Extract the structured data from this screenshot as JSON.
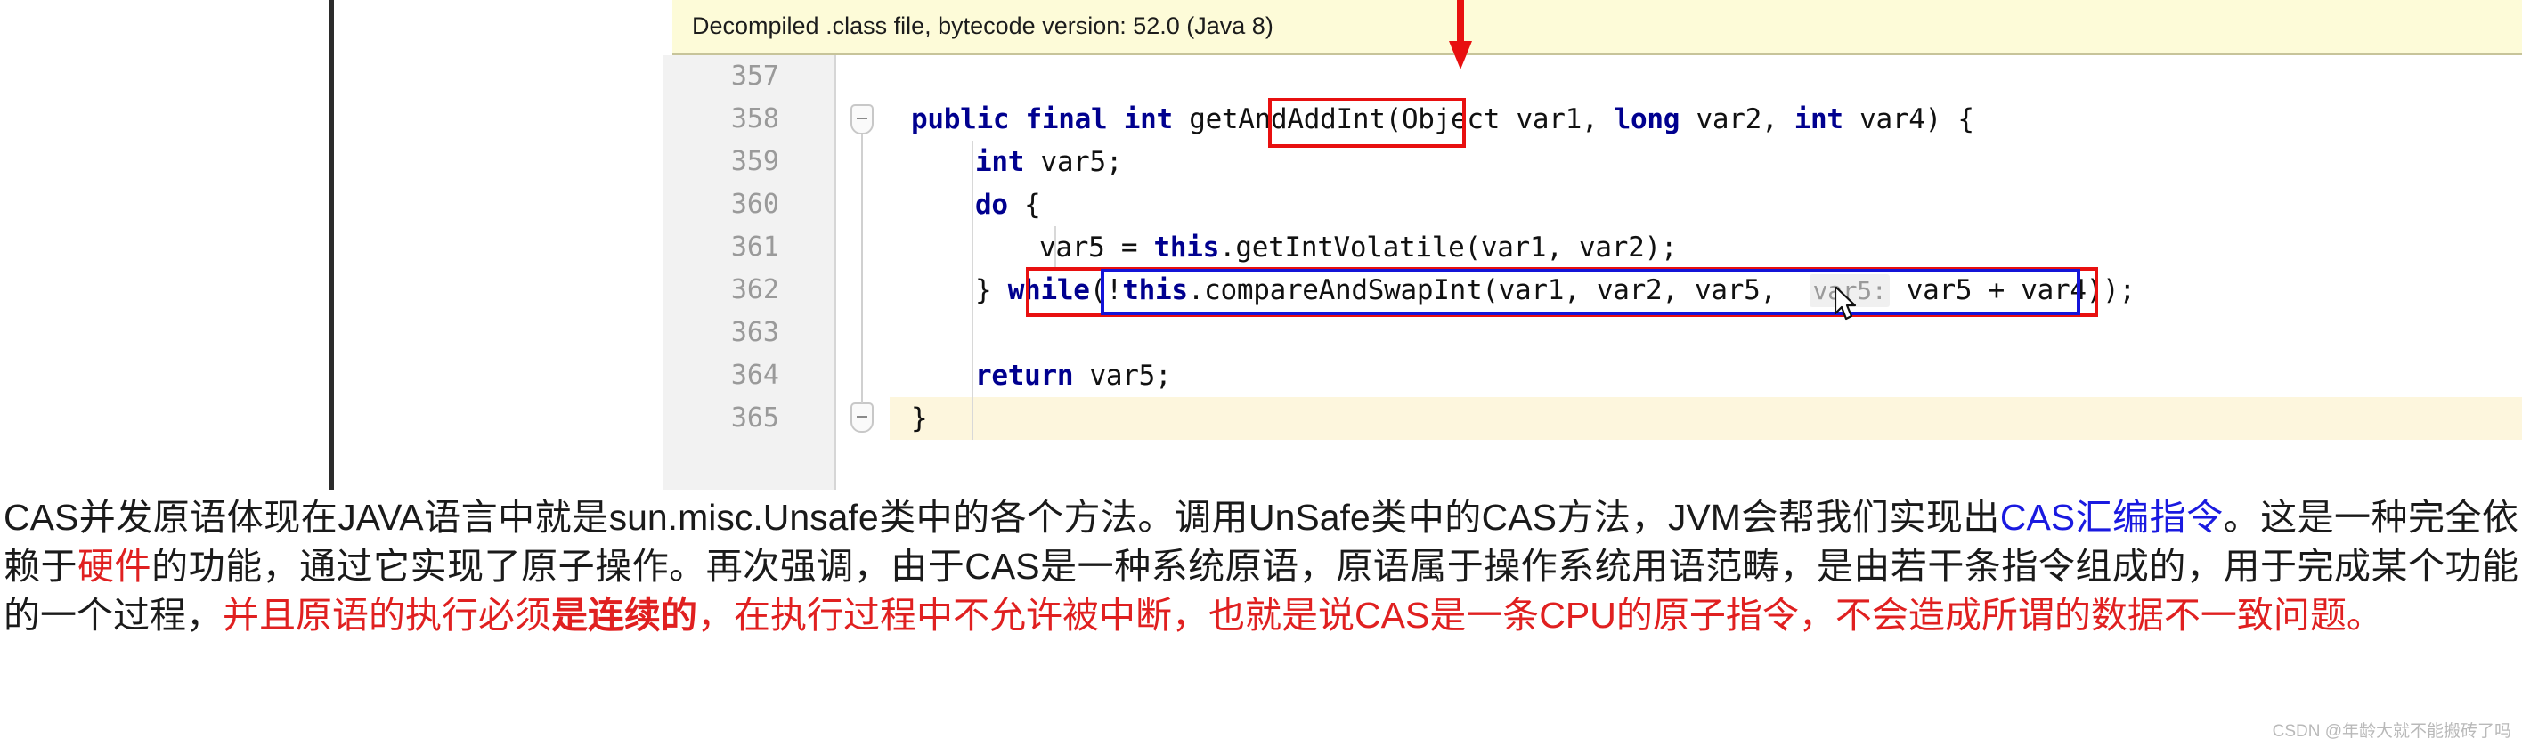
{
  "editor": {
    "banner": {
      "text": "Decompiled .class file, bytecode version: 52.0 (Java 8)"
    },
    "line_numbers": [
      "357",
      "358",
      "359",
      "360",
      "361",
      "362",
      "363",
      "364",
      "365"
    ],
    "code_lines": [
      {
        "n": "357",
        "text": ""
      },
      {
        "n": "358",
        "text": "    public final int getAndAddInt(Object var1, long var2, int var4) {"
      },
      {
        "n": "359",
        "text": "        int var5;"
      },
      {
        "n": "360",
        "text": "        do {"
      },
      {
        "n": "361",
        "text": "            var5 = this.getIntVolatile(var1, var2);"
      },
      {
        "n": "362",
        "text": "        } while(!this.compareAndSwapInt(var1, var2, var5,  var5: var5 + var4));"
      },
      {
        "n": "363",
        "text": ""
      },
      {
        "n": "364",
        "text": "        return var5;"
      },
      {
        "n": "365",
        "text": "    }"
      }
    ],
    "tokens": {
      "l358_kw1": "public final int",
      "l358_name": "getAndAddInt",
      "l358_mid": "(Object var1, ",
      "l358_kw2": "long",
      "l358_mid2": " var2, ",
      "l358_kw3": "int",
      "l358_end": " var4) {",
      "l359_kw": "int",
      "l359_rest": " var5;",
      "l360_kw": "do",
      "l360_rest": " {",
      "l361_a": "var5 = ",
      "l361_kw": "this",
      "l361_rest": ".getIntVolatile(var1, var2);",
      "l362_a": "} ",
      "l362_kw1": "while",
      "l362_b": "(!",
      "l362_kw2": "this",
      "l362_c": ".compareAndSwapInt(var1, var2, var5,  ",
      "l362_hint": "var5:",
      "l362_d": " var5 + var4));",
      "l364_kw": "return",
      "l364_rest": " var5;",
      "l365": "}"
    },
    "annotations": {
      "method_box_label": "getAndAddInt",
      "arrow_label": "down-arrow-to-method-name",
      "red_outer_box_label": "compareAndSwapInt-call-red-box",
      "blue_inner_box_label": "compareAndSwapInt-args-blue-box"
    }
  },
  "prose": {
    "s1": "CAS并发原语体现在JAVA语言中就是sun.misc.Unsafe类中的各个方法。调用UnSafe类中的CAS方法，JVM会帮我们实现出",
    "s2_blue": "CAS汇编指令",
    "s3": "。这是一种完全依赖于",
    "s4_red": "硬件",
    "s5": "的功能，通过它实现了原子操作。再次强调，由于CAS是一种系统原语，原语属于操作系统用语范畴，是由若干条指令组成的，用于完成某个功能的一个过程，",
    "s6_red": "并且原语的执行必须",
    "s7_red_bold": "是连续的",
    "s8_red": "，在执行过程中不允许被中断，也就是说CAS是一条CPU的原子指令，不会造成所谓的数据不一致问题。"
  },
  "watermark": {
    "text": "CSDN @年龄大就不能搬砖了吗"
  },
  "colors": {
    "banner_bg": "#fdfbd8",
    "gutter_bg": "#f2f2f2",
    "keyword": "#00008f",
    "red_box": "#e81010",
    "blue_box": "#1414d8",
    "prose_blue": "#1a1ae0",
    "prose_red": "#e02020",
    "row_highlight": "#fdf6dd"
  }
}
